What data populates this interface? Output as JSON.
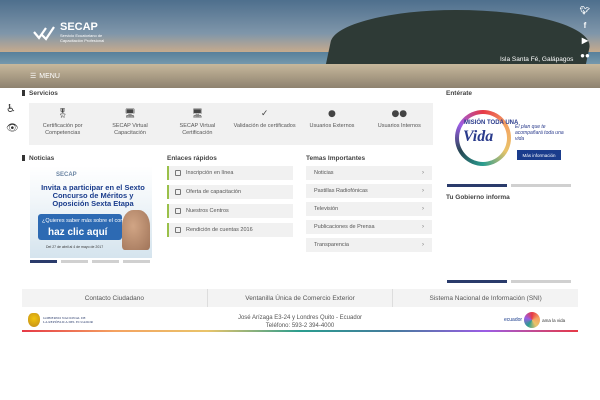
{
  "header": {
    "brand": "SECAP",
    "brand_sub_1": "Servicio Ecuatoriano de",
    "brand_sub_2": "Capacitación Profesional",
    "photo_caption": "Isla Santa Fé, Galápagos",
    "menu_label": "MENU",
    "social": [
      "twitter-icon",
      "facebook-icon",
      "youtube-icon",
      "flickr-icon"
    ]
  },
  "services": {
    "title": "Servicios",
    "items": [
      {
        "label": "Certificación por Competencias",
        "icon": "certificate-icon"
      },
      {
        "label": "SECAP Virtual Capacitación",
        "icon": "monitor-icon"
      },
      {
        "label": "SECAP Virtual Certificación",
        "icon": "monitor-icon"
      },
      {
        "label": "Validación de certificados",
        "icon": "check-icon"
      },
      {
        "label": "Usuarios Externos",
        "icon": "user-icon"
      },
      {
        "label": "Usuarios Internos",
        "icon": "users-icon"
      }
    ]
  },
  "news": {
    "title": "Noticias",
    "banner_brand": "SECAP",
    "banner_headline": "Invita a participar en el Sexto Concurso de Méritos y Oposición Sexta Etapa",
    "banner_question": "¿Quieres saber más sobre el concurso?",
    "banner_cta": "haz clic aquí",
    "banner_fine": "Del 27 de abril al 4 de mayo de 2017"
  },
  "quick_links": {
    "title": "Enlaces rápidos",
    "items": [
      "Inscripción en línea",
      "Oferta de capacitación",
      "Nuestros Centros",
      "Rendición de cuentas 2016"
    ]
  },
  "topics": {
    "title": "Temas Importantes",
    "items": [
      "Noticias",
      "Pastillas Radiofónicas",
      "Televisión",
      "Publicaciones de Prensa",
      "Transparencia"
    ]
  },
  "sidebar": {
    "enterate_title": "Entérate",
    "mision_small": "MISIÓN TODA UNA",
    "mision_big": "Vida",
    "mision_tag": "El plan que te acompañará toda una vida",
    "mision_button": "Más información",
    "gob_title": "Tu Gobierno informa"
  },
  "bottom_links": [
    "Contacto Ciudadano",
    "Ventanilla Única de Comercio Exterior",
    "Sistema Nacional de Información (SNI)"
  ],
  "footer": {
    "address": "José Arízaga E3-24 y Londres Quito - Ecuador",
    "phone": "Teléfono: 593-2 394-4000",
    "gov_line1": "GOBIERNO NACIONAL DE",
    "gov_line2": "LA REPÚBLICA DEL ECUADOR",
    "ecuador_word": "ecuador",
    "ama": "ama la vida"
  }
}
